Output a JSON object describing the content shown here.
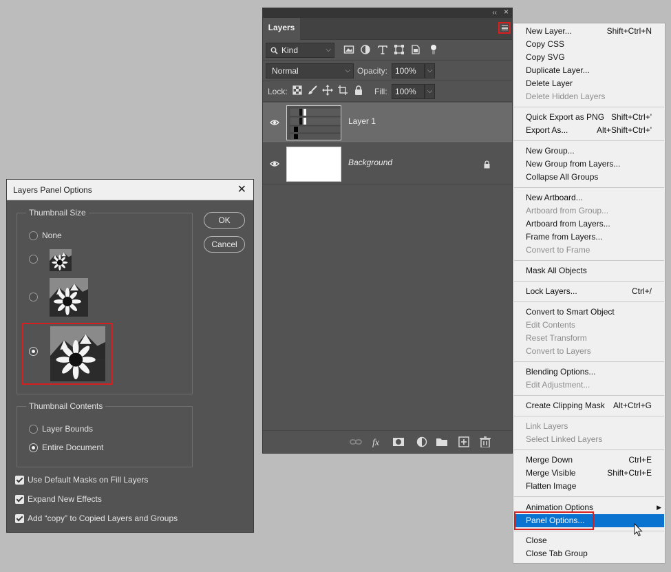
{
  "layers_panel": {
    "tab_label": "Layers",
    "filter_kind": "Kind",
    "blend_mode": "Normal",
    "opacity_label": "Opacity:",
    "opacity_value": "100%",
    "lock_label": "Lock:",
    "fill_label": "Fill:",
    "fill_value": "100%",
    "layers": [
      {
        "name": "Layer 1",
        "visible": true,
        "selected": true,
        "italic": false,
        "locked": false
      },
      {
        "name": "Background",
        "visible": true,
        "selected": false,
        "italic": true,
        "locked": true
      }
    ],
    "collapse_glyph": "‹‹",
    "close_glyph": "×"
  },
  "flyout_menu": {
    "items": [
      {
        "label": "New Layer...",
        "shortcut": "Shift+Ctrl+N",
        "disabled": false
      },
      {
        "label": "Copy CSS",
        "shortcut": "",
        "disabled": false
      },
      {
        "label": "Copy SVG",
        "shortcut": "",
        "disabled": false
      },
      {
        "label": "Duplicate Layer...",
        "shortcut": "",
        "disabled": false
      },
      {
        "label": "Delete Layer",
        "shortcut": "",
        "disabled": false
      },
      {
        "label": "Delete Hidden Layers",
        "shortcut": "",
        "disabled": true
      },
      {
        "label": "Quick Export as PNG",
        "shortcut": "Shift+Ctrl+'",
        "disabled": false
      },
      {
        "label": "Export As...",
        "shortcut": "Alt+Shift+Ctrl+'",
        "disabled": false
      },
      {
        "label": "New Group...",
        "shortcut": "",
        "disabled": false
      },
      {
        "label": "New Group from Layers...",
        "shortcut": "",
        "disabled": false
      },
      {
        "label": "Collapse All Groups",
        "shortcut": "",
        "disabled": false
      },
      {
        "label": "New Artboard...",
        "shortcut": "",
        "disabled": false
      },
      {
        "label": "Artboard from Group...",
        "shortcut": "",
        "disabled": true
      },
      {
        "label": "Artboard from Layers...",
        "shortcut": "",
        "disabled": false
      },
      {
        "label": "Frame from Layers...",
        "shortcut": "",
        "disabled": false
      },
      {
        "label": "Convert to Frame",
        "shortcut": "",
        "disabled": true
      },
      {
        "label": "Mask All Objects",
        "shortcut": "",
        "disabled": false
      },
      {
        "label": "Lock Layers...",
        "shortcut": "Ctrl+/",
        "disabled": false
      },
      {
        "label": "Convert to Smart Object",
        "shortcut": "",
        "disabled": false
      },
      {
        "label": "Edit Contents",
        "shortcut": "",
        "disabled": true
      },
      {
        "label": "Reset Transform",
        "shortcut": "",
        "disabled": true
      },
      {
        "label": "Convert to Layers",
        "shortcut": "",
        "disabled": true
      },
      {
        "label": "Blending Options...",
        "shortcut": "",
        "disabled": false
      },
      {
        "label": "Edit Adjustment...",
        "shortcut": "",
        "disabled": true
      },
      {
        "label": "Create Clipping Mask",
        "shortcut": "Alt+Ctrl+G",
        "disabled": false
      },
      {
        "label": "Link Layers",
        "shortcut": "",
        "disabled": true
      },
      {
        "label": "Select Linked Layers",
        "shortcut": "",
        "disabled": true
      },
      {
        "label": "Merge Down",
        "shortcut": "Ctrl+E",
        "disabled": false
      },
      {
        "label": "Merge Visible",
        "shortcut": "Shift+Ctrl+E",
        "disabled": false
      },
      {
        "label": "Flatten Image",
        "shortcut": "",
        "disabled": false
      },
      {
        "label": "Animation Options",
        "shortcut": "",
        "disabled": false,
        "submenu": true
      },
      {
        "label": "Panel Options...",
        "shortcut": "",
        "disabled": false,
        "highlighted": true
      },
      {
        "label": "Close",
        "shortcut": "",
        "disabled": false
      },
      {
        "label": "Close Tab Group",
        "shortcut": "",
        "disabled": false
      }
    ]
  },
  "dialog": {
    "title": "Layers Panel Options",
    "close_glyph": "✕",
    "thumbnail_size_title": "Thumbnail Size",
    "thumbnail_none_label": "None",
    "thumbnail_selected_index": 3,
    "thumbnail_contents_title": "Thumbnail Contents",
    "contents_options": [
      {
        "label": "Layer Bounds",
        "selected": false
      },
      {
        "label": "Entire Document",
        "selected": true
      }
    ],
    "ok_label": "OK",
    "cancel_label": "Cancel",
    "checkboxes": [
      {
        "label": "Use Default Masks on Fill Layers",
        "checked": true
      },
      {
        "label": "Expand New Effects",
        "checked": true
      },
      {
        "label": "Add “copy” to Copied Layers and Groups",
        "checked": true
      }
    ]
  },
  "colors": {
    "highlight_blue": "#0a72cf",
    "callout_red": "#d71f1f",
    "panel_gray": "#535353"
  }
}
